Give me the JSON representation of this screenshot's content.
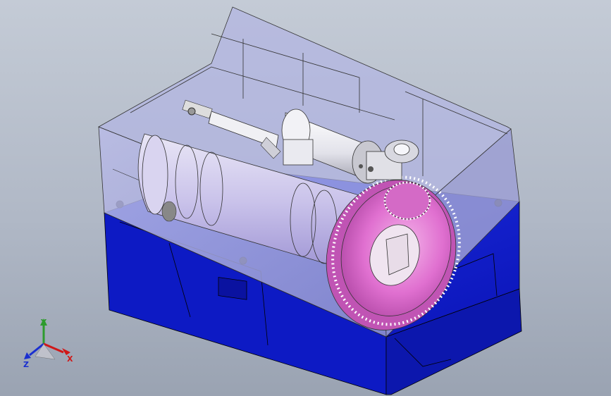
{
  "viewport": {
    "background_top": "#c4cbd6",
    "background_bottom": "#9aa3b2"
  },
  "model": {
    "housing_upper_color": "#a8aad8",
    "housing_lower_color": "#1424d8",
    "gear_color": "#e070d0",
    "motor_color": "#e8e8ee"
  },
  "triad": {
    "x_label": "X",
    "y_label": "Y",
    "z_label": "Z",
    "x_color": "#d01818",
    "y_color": "#2e9b2e",
    "z_color": "#1a2fd0"
  }
}
